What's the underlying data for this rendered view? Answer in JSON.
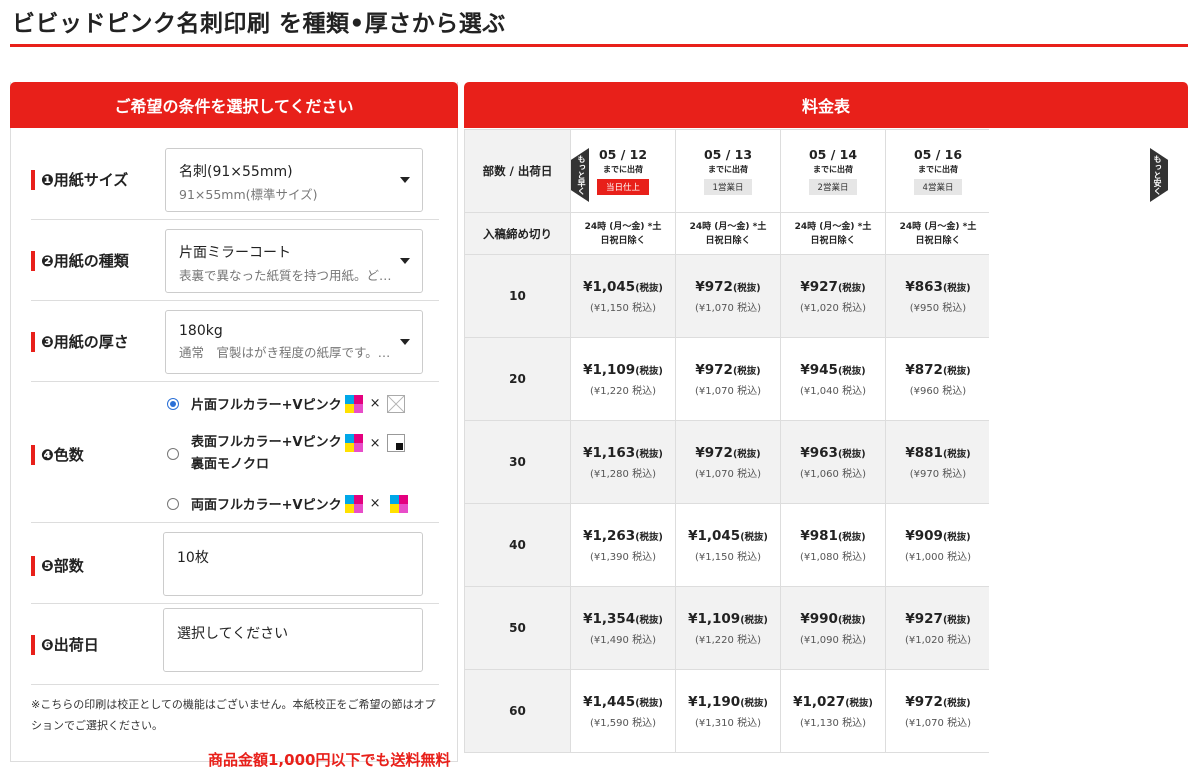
{
  "page": {
    "title": "ビビッドピンク名刺印刷 を種類•厚さから選ぶ"
  },
  "form": {
    "header": "ご希望の条件を選択してください",
    "paper_size": {
      "label": "❶用紙サイズ",
      "value": "名刺(91×55mm)",
      "sub": "91×55mm(標準サイズ)"
    },
    "paper_type": {
      "label": "❷用紙の種類",
      "value": "片面ミラーコート",
      "sub": "表裏で異なった紙質を持つ用紙。どちらかといえば"
    },
    "thickness": {
      "label": "❸用紙の厚さ",
      "value": "180kg",
      "sub": "通常　官製はがき程度の紙厚です。名刺に最適"
    },
    "colors": {
      "label": "❹色数",
      "times": "×",
      "options": [
        {
          "label": "片面フルカラー+Vピンク",
          "checked": true
        },
        {
          "label_line1": "表面フルカラー+Vピンク",
          "label_line2": "裏面モノクロ",
          "checked": false
        },
        {
          "label": "両面フルカラー+Vピンク",
          "checked": false
        }
      ]
    },
    "quantity": {
      "label": "❺部数",
      "value": "10枚"
    },
    "ship_date": {
      "label": "❻出荷日",
      "value": "選択してください"
    },
    "note": "※こちらの印刷は校正としての機能はございません。本紙校正をご希望の節はオプションでご選択ください。",
    "free_shipping": "商品金額1,000円以下でも送料無料"
  },
  "price_table": {
    "header": "料金表",
    "corner_label": "部数 / 出荷日",
    "cutoff_label": "入稿締め切り",
    "faster_label": "もっと早く",
    "cheaper_label": "もっと安く",
    "dates": [
      {
        "date": "05 / 12",
        "sub": "までに出荷",
        "badge": "当日仕上",
        "badge_red": true,
        "cutoff_line1": "24時 (月〜金) *土",
        "cutoff_line2": "日祝日除く"
      },
      {
        "date": "05 / 13",
        "sub": "までに出荷",
        "badge": "1営業日",
        "badge_red": false,
        "cutoff_line1": "24時 (月〜金) *土",
        "cutoff_line2": "日祝日除く"
      },
      {
        "date": "05 / 14",
        "sub": "までに出荷",
        "badge": "2営業日",
        "badge_red": false,
        "cutoff_line1": "24時 (月〜金) *土",
        "cutoff_line2": "日祝日除く"
      },
      {
        "date": "05 / 16",
        "sub": "までに出荷",
        "badge": "4営業日",
        "badge_red": false,
        "cutoff_line1": "24時 (月〜金) *土",
        "cutoff_line2": "日祝日除く"
      }
    ],
    "tax_excl": "(税抜)",
    "rows": [
      {
        "qty": "10",
        "prices": [
          {
            "main": "¥1,045",
            "incl": "(¥1,150 税込)"
          },
          {
            "main": "¥972",
            "incl": "(¥1,070 税込)"
          },
          {
            "main": "¥927",
            "incl": "(¥1,020 税込)"
          },
          {
            "main": "¥863",
            "incl": "(¥950 税込)"
          }
        ]
      },
      {
        "qty": "20",
        "prices": [
          {
            "main": "¥1,109",
            "incl": "(¥1,220 税込)"
          },
          {
            "main": "¥972",
            "incl": "(¥1,070 税込)"
          },
          {
            "main": "¥945",
            "incl": "(¥1,040 税込)"
          },
          {
            "main": "¥872",
            "incl": "(¥960 税込)"
          }
        ]
      },
      {
        "qty": "30",
        "prices": [
          {
            "main": "¥1,163",
            "incl": "(¥1,280 税込)"
          },
          {
            "main": "¥972",
            "incl": "(¥1,070 税込)"
          },
          {
            "main": "¥963",
            "incl": "(¥1,060 税込)"
          },
          {
            "main": "¥881",
            "incl": "(¥970 税込)"
          }
        ]
      },
      {
        "qty": "40",
        "prices": [
          {
            "main": "¥1,263",
            "incl": "(¥1,390 税込)"
          },
          {
            "main": "¥1,045",
            "incl": "(¥1,150 税込)"
          },
          {
            "main": "¥981",
            "incl": "(¥1,080 税込)"
          },
          {
            "main": "¥909",
            "incl": "(¥1,000 税込)"
          }
        ]
      },
      {
        "qty": "50",
        "prices": [
          {
            "main": "¥1,354",
            "incl": "(¥1,490 税込)"
          },
          {
            "main": "¥1,109",
            "incl": "(¥1,220 税込)"
          },
          {
            "main": "¥990",
            "incl": "(¥1,090 税込)"
          },
          {
            "main": "¥927",
            "incl": "(¥1,020 税込)"
          }
        ]
      },
      {
        "qty": "60",
        "prices": [
          {
            "main": "¥1,445",
            "incl": "(¥1,590 税込)"
          },
          {
            "main": "¥1,190",
            "incl": "(¥1,310 税込)"
          },
          {
            "main": "¥1,027",
            "incl": "(¥1,130 税込)"
          },
          {
            "main": "¥972",
            "incl": "(¥1,070 税込)"
          }
        ]
      }
    ]
  },
  "colors": {
    "accent": "#e8201a",
    "shade": "#f2f2f2",
    "radio": "#2a6fd6"
  }
}
